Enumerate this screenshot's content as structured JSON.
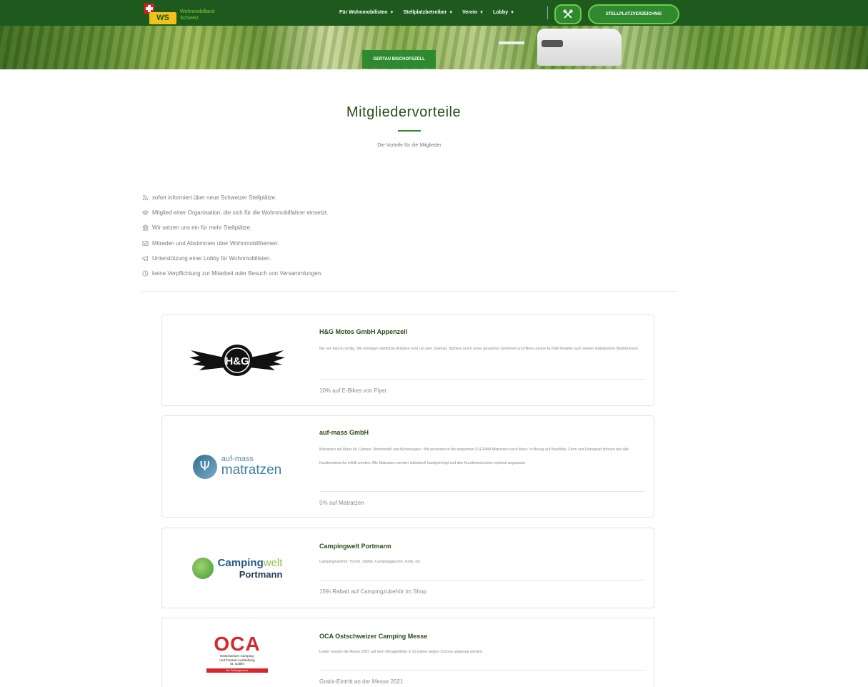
{
  "header": {
    "brand_line1": "Wohnmobilland",
    "brand_line2": "Schweiz",
    "logo_mark": "WS",
    "nav": [
      {
        "label": "Für Wohnmobilisten"
      },
      {
        "label": "Stellplatzbetreiber"
      },
      {
        "label": "Verein"
      },
      {
        "label": "Lobby"
      }
    ],
    "directory_button": "STELLPLATZVERZEICHNIS",
    "location_button": "GERTAU BISCHOFSZELL"
  },
  "section": {
    "title": "Mitgliedervorteile",
    "subtitle": "Die Vorteile für die Mitglieder"
  },
  "benefits": [
    {
      "icon": "rss-icon",
      "text": "sofort informiert über neue Schweizer Stellplätze."
    },
    {
      "icon": "graduation-cap-icon",
      "text": "Mitglied einer Organisation, die sich für die Wohnmobilfahrer einsetzt."
    },
    {
      "icon": "institution-icon",
      "text": "Wir setzen uns ein für mehr Stellplätze."
    },
    {
      "icon": "vote-icon",
      "text": "Mitreden und Abstimmen über Wohnmobilthemen."
    },
    {
      "icon": "megaphone-icon",
      "text": "Unterstützung einer Lobby für Wohnmobilisten."
    },
    {
      "icon": "clock-icon",
      "text": "keine Verpflichtung zur Mitarbeit oder Besuch von Versammlungen."
    }
  ],
  "partners": [
    {
      "name": "H&G Motos GmbH Appenzell",
      "logo_text": "H&G",
      "description": "Bei uns bist du richtig. Wir erledigen sämtliche Arbeiten rund um dein Zweirad. Stöbere durch unser gesamtes Sortiment und filtere unsere FLYER Modelle nach deinen individuellen Bedürfnissen.",
      "offer": "10% auf E-Bikes von Flyer"
    },
    {
      "name": "auf-mass GmbH",
      "logo_text_top": "auf-mass",
      "logo_text_main": "matratzen",
      "description": "Matratzen auf Mass für Camper, Wohnmobil und Wohnwagen ! Wir produzieren die bequemen FLEXIMA Matratzen nach Mass. In Bezug auf Bauhöhe, Form und Härtegrad können fast alle Kundenwünsche erfüllt werden. Alle Matratzen werden individuell handgefertigt und den Kundenwünschen optimal angepasst.",
      "offer": "5% auf Matratzen"
    },
    {
      "name": "Campingwelt Portmann",
      "logo_text_a": "Camping",
      "logo_text_b": "welt",
      "logo_text_c": "Portmann",
      "description": "Campingzubehör: Tische, Stühle, Campinggeschirr, Grills, etc.",
      "offer": "15% Rabatt auf Campingzubehör im Shop"
    },
    {
      "name": "OCA Ostschweizer Camping Messe",
      "logo_text_big": "OCA",
      "logo_text_l1": "Ostschweizer Camping-",
      "logo_text_l2": "und Freizeit-Ausstellung",
      "logo_text_l3": "St. Gallen",
      "logo_text_bar": "Die Frühlingsmesse",
      "description": "Leider musste die Messe 2021 auf dem Olmagelände in St.Gallen wegen Corona abgesagt werden.",
      "offer": "Gratis-Eintritt an der Messe 2021"
    }
  ],
  "colors": {
    "nav_bg": "#1e5a1e",
    "accent": "#2f8a2f",
    "title": "#2b4d18"
  }
}
